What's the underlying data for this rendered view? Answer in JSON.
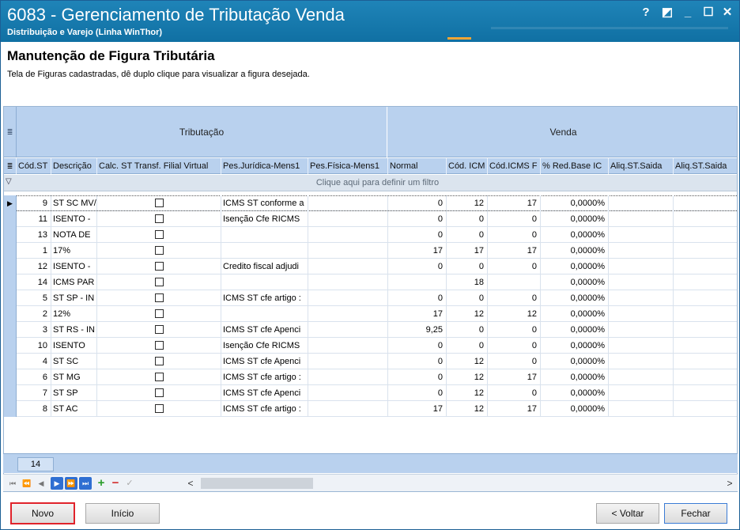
{
  "window": {
    "title": "6083 - Gerenciamento de Tributação Venda",
    "subtitle": "Distribuição e Varejo (Linha WinThor)",
    "controls": {
      "help": "?",
      "restore": "◩",
      "minimize": "_",
      "maximize": "☐",
      "close": "✕"
    }
  },
  "header": {
    "title": "Manutenção de Figura Tributária",
    "description": "Tela de Figuras cadastradas, dê duplo clique para visualizar a figura desejada."
  },
  "grid": {
    "bands": {
      "tributacao": "Tributação",
      "venda": "Venda"
    },
    "columns": [
      "Cód.ST",
      "Descrição",
      "Calc. ST Transf. Filial Virtual",
      "Pes.Jurídica-Mens1",
      "Pes.Física-Mens1",
      "Normal",
      "Cód. ICM",
      "Cód.ICMS F",
      "% Red.Base IC",
      "Aliq.ST.Saida",
      "Aliq.ST.Saida"
    ],
    "filter_text": "Clique aqui para definir um filtro",
    "rows": [
      {
        "cod": "9",
        "desc": "ST SC MV/",
        "pj": "ICMS ST conforme a",
        "normal": "0",
        "cod_icm": "12",
        "cod_icms_f": "17",
        "red": "0,0000%"
      },
      {
        "cod": "11",
        "desc": "ISENTO -",
        "pj": "Isenção Cfe RICMS",
        "normal": "0",
        "cod_icm": "0",
        "cod_icms_f": "0",
        "red": "0,0000%"
      },
      {
        "cod": "13",
        "desc": "NOTA DE",
        "pj": "",
        "normal": "0",
        "cod_icm": "0",
        "cod_icms_f": "0",
        "red": "0,0000%"
      },
      {
        "cod": "1",
        "desc": "17%",
        "pj": "",
        "normal": "17",
        "cod_icm": "17",
        "cod_icms_f": "17",
        "red": "0,0000%"
      },
      {
        "cod": "12",
        "desc": "ISENTO -",
        "pj": "Credito fiscal adjudi",
        "normal": "0",
        "cod_icm": "0",
        "cod_icms_f": "0",
        "red": "0,0000%"
      },
      {
        "cod": "14",
        "desc": "ICMS PAR",
        "pj": "",
        "normal": "",
        "cod_icm": "18",
        "cod_icms_f": "",
        "red": "0,0000%"
      },
      {
        "cod": "5",
        "desc": "ST SP - IN",
        "pj": "ICMS ST cfe artigo :",
        "normal": "0",
        "cod_icm": "0",
        "cod_icms_f": "0",
        "red": "0,0000%"
      },
      {
        "cod": "2",
        "desc": "12%",
        "pj": "",
        "normal": "17",
        "cod_icm": "12",
        "cod_icms_f": "12",
        "red": "0,0000%"
      },
      {
        "cod": "3",
        "desc": "ST RS - IN",
        "pj": "ICMS ST cfe Apenci",
        "normal": "9,25",
        "cod_icm": "0",
        "cod_icms_f": "0",
        "red": "0,0000%"
      },
      {
        "cod": "10",
        "desc": "ISENTO",
        "pj": "Isenção Cfe RICMS",
        "normal": "0",
        "cod_icm": "0",
        "cod_icms_f": "0",
        "red": "0,0000%"
      },
      {
        "cod": "4",
        "desc": "ST SC",
        "pj": "ICMS ST cfe Apenci",
        "normal": "0",
        "cod_icm": "12",
        "cod_icms_f": "0",
        "red": "0,0000%"
      },
      {
        "cod": "6",
        "desc": "ST MG",
        "pj": "ICMS ST cfe artigo :",
        "normal": "0",
        "cod_icm": "12",
        "cod_icms_f": "17",
        "red": "0,0000%"
      },
      {
        "cod": "7",
        "desc": "ST SP",
        "pj": "ICMS ST cfe Apenci",
        "normal": "0",
        "cod_icm": "12",
        "cod_icms_f": "0",
        "red": "0,0000%"
      },
      {
        "cod": "8",
        "desc": "ST AC",
        "pj": "ICMS ST cfe artigo :",
        "normal": "17",
        "cod_icm": "12",
        "cod_icms_f": "17",
        "red": "0,0000%"
      }
    ],
    "record_count": "14"
  },
  "navigator": {
    "scroll_left": "<",
    "scroll_right": ">"
  },
  "buttons": {
    "novo": "Novo",
    "inicio": "Início",
    "voltar": "< Voltar",
    "fechar": "Fechar"
  },
  "colors": {
    "titlebar": "#1878ad",
    "accent": "#f2a534",
    "grid_header": "#b9d1ee",
    "highlight_border": "#e0232b"
  }
}
